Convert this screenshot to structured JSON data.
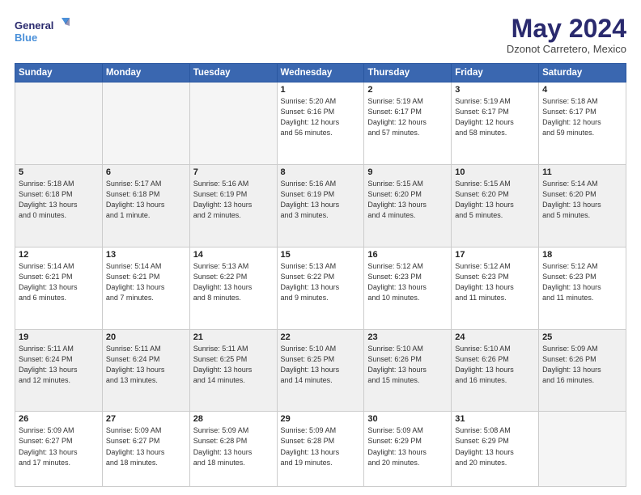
{
  "logo": {
    "line1": "General",
    "line2": "Blue"
  },
  "title": "May 2024",
  "subtitle": "Dzonot Carretero, Mexico",
  "weekdays": [
    "Sunday",
    "Monday",
    "Tuesday",
    "Wednesday",
    "Thursday",
    "Friday",
    "Saturday"
  ],
  "weeks": [
    [
      {
        "day": "",
        "info": ""
      },
      {
        "day": "",
        "info": ""
      },
      {
        "day": "",
        "info": ""
      },
      {
        "day": "1",
        "info": "Sunrise: 5:20 AM\nSunset: 6:16 PM\nDaylight: 12 hours\nand 56 minutes."
      },
      {
        "day": "2",
        "info": "Sunrise: 5:19 AM\nSunset: 6:17 PM\nDaylight: 12 hours\nand 57 minutes."
      },
      {
        "day": "3",
        "info": "Sunrise: 5:19 AM\nSunset: 6:17 PM\nDaylight: 12 hours\nand 58 minutes."
      },
      {
        "day": "4",
        "info": "Sunrise: 5:18 AM\nSunset: 6:17 PM\nDaylight: 12 hours\nand 59 minutes."
      }
    ],
    [
      {
        "day": "5",
        "info": "Sunrise: 5:18 AM\nSunset: 6:18 PM\nDaylight: 13 hours\nand 0 minutes."
      },
      {
        "day": "6",
        "info": "Sunrise: 5:17 AM\nSunset: 6:18 PM\nDaylight: 13 hours\nand 1 minute."
      },
      {
        "day": "7",
        "info": "Sunrise: 5:16 AM\nSunset: 6:19 PM\nDaylight: 13 hours\nand 2 minutes."
      },
      {
        "day": "8",
        "info": "Sunrise: 5:16 AM\nSunset: 6:19 PM\nDaylight: 13 hours\nand 3 minutes."
      },
      {
        "day": "9",
        "info": "Sunrise: 5:15 AM\nSunset: 6:20 PM\nDaylight: 13 hours\nand 4 minutes."
      },
      {
        "day": "10",
        "info": "Sunrise: 5:15 AM\nSunset: 6:20 PM\nDaylight: 13 hours\nand 5 minutes."
      },
      {
        "day": "11",
        "info": "Sunrise: 5:14 AM\nSunset: 6:20 PM\nDaylight: 13 hours\nand 5 minutes."
      }
    ],
    [
      {
        "day": "12",
        "info": "Sunrise: 5:14 AM\nSunset: 6:21 PM\nDaylight: 13 hours\nand 6 minutes."
      },
      {
        "day": "13",
        "info": "Sunrise: 5:14 AM\nSunset: 6:21 PM\nDaylight: 13 hours\nand 7 minutes."
      },
      {
        "day": "14",
        "info": "Sunrise: 5:13 AM\nSunset: 6:22 PM\nDaylight: 13 hours\nand 8 minutes."
      },
      {
        "day": "15",
        "info": "Sunrise: 5:13 AM\nSunset: 6:22 PM\nDaylight: 13 hours\nand 9 minutes."
      },
      {
        "day": "16",
        "info": "Sunrise: 5:12 AM\nSunset: 6:23 PM\nDaylight: 13 hours\nand 10 minutes."
      },
      {
        "day": "17",
        "info": "Sunrise: 5:12 AM\nSunset: 6:23 PM\nDaylight: 13 hours\nand 11 minutes."
      },
      {
        "day": "18",
        "info": "Sunrise: 5:12 AM\nSunset: 6:23 PM\nDaylight: 13 hours\nand 11 minutes."
      }
    ],
    [
      {
        "day": "19",
        "info": "Sunrise: 5:11 AM\nSunset: 6:24 PM\nDaylight: 13 hours\nand 12 minutes."
      },
      {
        "day": "20",
        "info": "Sunrise: 5:11 AM\nSunset: 6:24 PM\nDaylight: 13 hours\nand 13 minutes."
      },
      {
        "day": "21",
        "info": "Sunrise: 5:11 AM\nSunset: 6:25 PM\nDaylight: 13 hours\nand 14 minutes."
      },
      {
        "day": "22",
        "info": "Sunrise: 5:10 AM\nSunset: 6:25 PM\nDaylight: 13 hours\nand 14 minutes."
      },
      {
        "day": "23",
        "info": "Sunrise: 5:10 AM\nSunset: 6:26 PM\nDaylight: 13 hours\nand 15 minutes."
      },
      {
        "day": "24",
        "info": "Sunrise: 5:10 AM\nSunset: 6:26 PM\nDaylight: 13 hours\nand 16 minutes."
      },
      {
        "day": "25",
        "info": "Sunrise: 5:09 AM\nSunset: 6:26 PM\nDaylight: 13 hours\nand 16 minutes."
      }
    ],
    [
      {
        "day": "26",
        "info": "Sunrise: 5:09 AM\nSunset: 6:27 PM\nDaylight: 13 hours\nand 17 minutes."
      },
      {
        "day": "27",
        "info": "Sunrise: 5:09 AM\nSunset: 6:27 PM\nDaylight: 13 hours\nand 18 minutes."
      },
      {
        "day": "28",
        "info": "Sunrise: 5:09 AM\nSunset: 6:28 PM\nDaylight: 13 hours\nand 18 minutes."
      },
      {
        "day": "29",
        "info": "Sunrise: 5:09 AM\nSunset: 6:28 PM\nDaylight: 13 hours\nand 19 minutes."
      },
      {
        "day": "30",
        "info": "Sunrise: 5:09 AM\nSunset: 6:29 PM\nDaylight: 13 hours\nand 20 minutes."
      },
      {
        "day": "31",
        "info": "Sunrise: 5:08 AM\nSunset: 6:29 PM\nDaylight: 13 hours\nand 20 minutes."
      },
      {
        "day": "",
        "info": ""
      }
    ]
  ]
}
